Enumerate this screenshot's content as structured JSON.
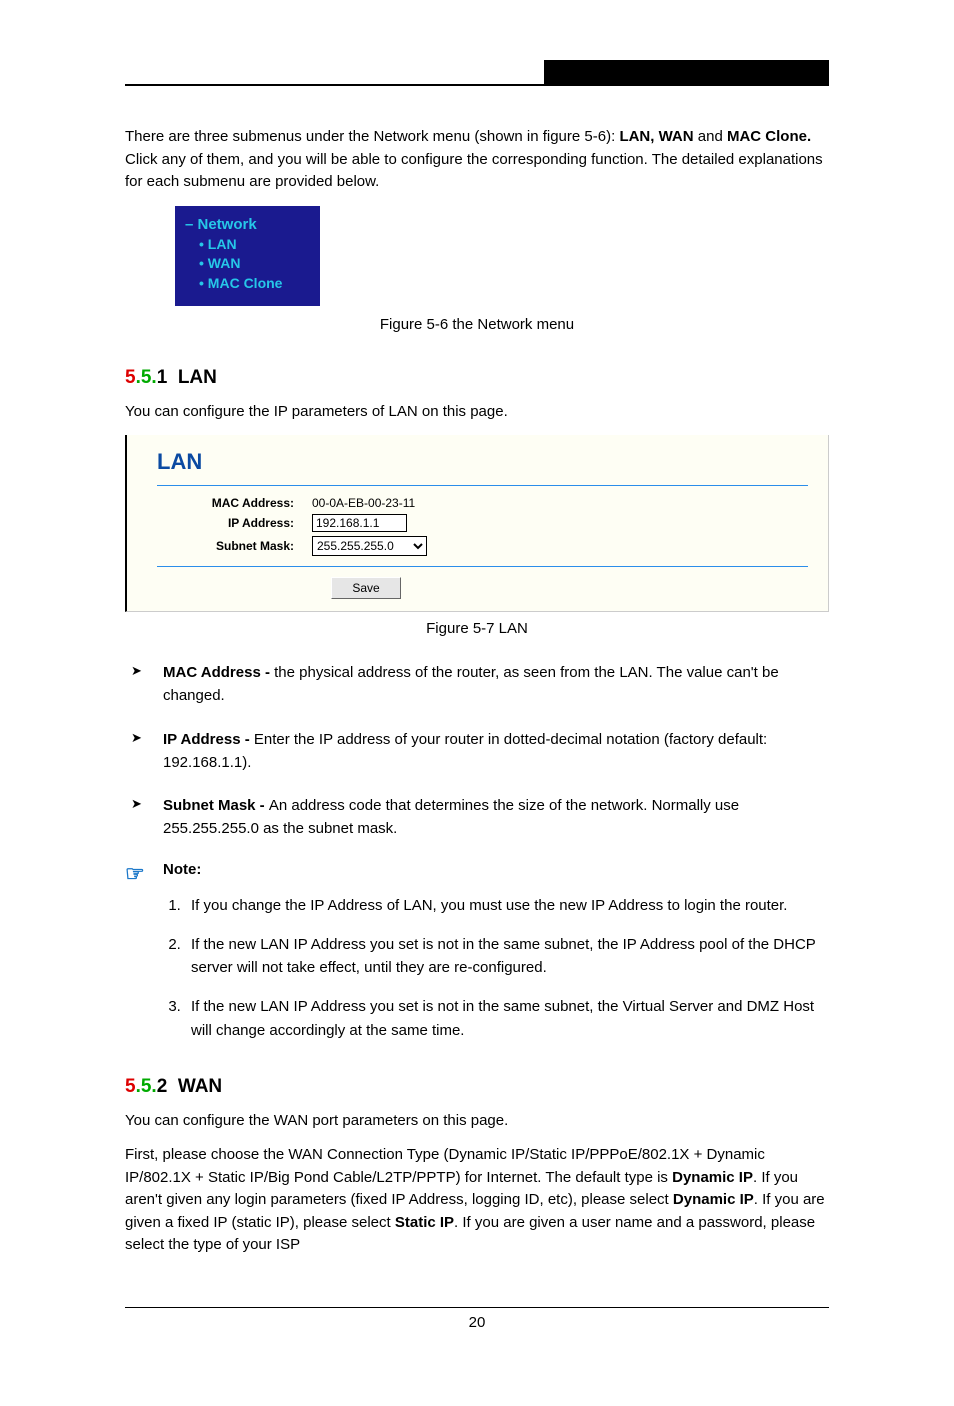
{
  "header": {
    "submenu_intro_prefix": "There are three submenus under the Network menu (shown in ",
    "figure_ref_3_6": "figure 5-6",
    "submenu_intro_mid": "): ",
    "submenu_list": "LAN, WAN",
    "submenu_intro_and": " and ",
    "submenu_mac": "MAC Clone.",
    "submenu_intro_suffix": " Click any of them, and you will be able to configure the corresponding function. The detailed explanations for each submenu are provided below."
  },
  "nav_figure": {
    "top": "– Network",
    "item1": "• LAN",
    "item2": "• WAN",
    "item3": "• MAC Clone"
  },
  "caption_3_6": "Figure 5-6 the Network menu",
  "lan_section": {
    "heading": "5.5.1  LAN",
    "intro_prefix": "You can configure the IP parameters of LAN on this page.",
    "title": "LAN",
    "mac_label": "MAC Address:",
    "mac_value": "00-0A-EB-00-23-11",
    "ip_label": "IP Address:",
    "ip_value": "192.168.1.1",
    "subnet_label": "Subnet Mask:",
    "subnet_value": "255.255.255.0",
    "save": "Save"
  },
  "caption_3_7": "Figure 5-7 LAN",
  "bullets": {
    "mac_b": "MAC Address - ",
    "mac_t": "the physical address of the router, as seen from the LAN. The value can't be changed.",
    "ip_b": "IP Address - ",
    "ip_t": "Enter the IP address of your router in dotted-decimal notation (factory default: 192.168.1.1).",
    "sub_b": "Subnet Mask - ",
    "sub_t": "An address code that determines the size of the network. Normally use 255.255.255.0 as the subnet mask."
  },
  "note": {
    "title": "Note:",
    "n1": "If you change the IP Address of LAN, you must use the new IP Address to login the router.",
    "n2": "If the new LAN IP Address you set is not in the same subnet, the IP Address pool of the DHCP server will not take effect, until they are re-configured.",
    "n3": "If the new LAN IP Address you set is not in the same subnet, the Virtual Server and DMZ Host will change accordingly at the same time."
  },
  "wan_section": {
    "heading": "5.5.2  WAN",
    "intro": "You can configure the WAN port parameters on this page.",
    "para2_prefix": "First, please choose the WAN Connection Type (Dynamic IP/Static IP/PPPoE/802.1X + Dynamic IP/802.1X + Static IP/Big Pond Cable/L2TP/PPTP) for Internet. The default type is ",
    "dyn_b": "Dynamic IP",
    "para2_mid": ". If you aren't given any login parameters (fixed IP Address, logging ID, etc), please select ",
    "para2_mid2": ". If you are given a fixed IP (static IP), please select ",
    "stat_b": "Static IP",
    "para2_mid3": ". If you are given a user name and a password, please select the type of your ISP"
  },
  "page_num": "20"
}
